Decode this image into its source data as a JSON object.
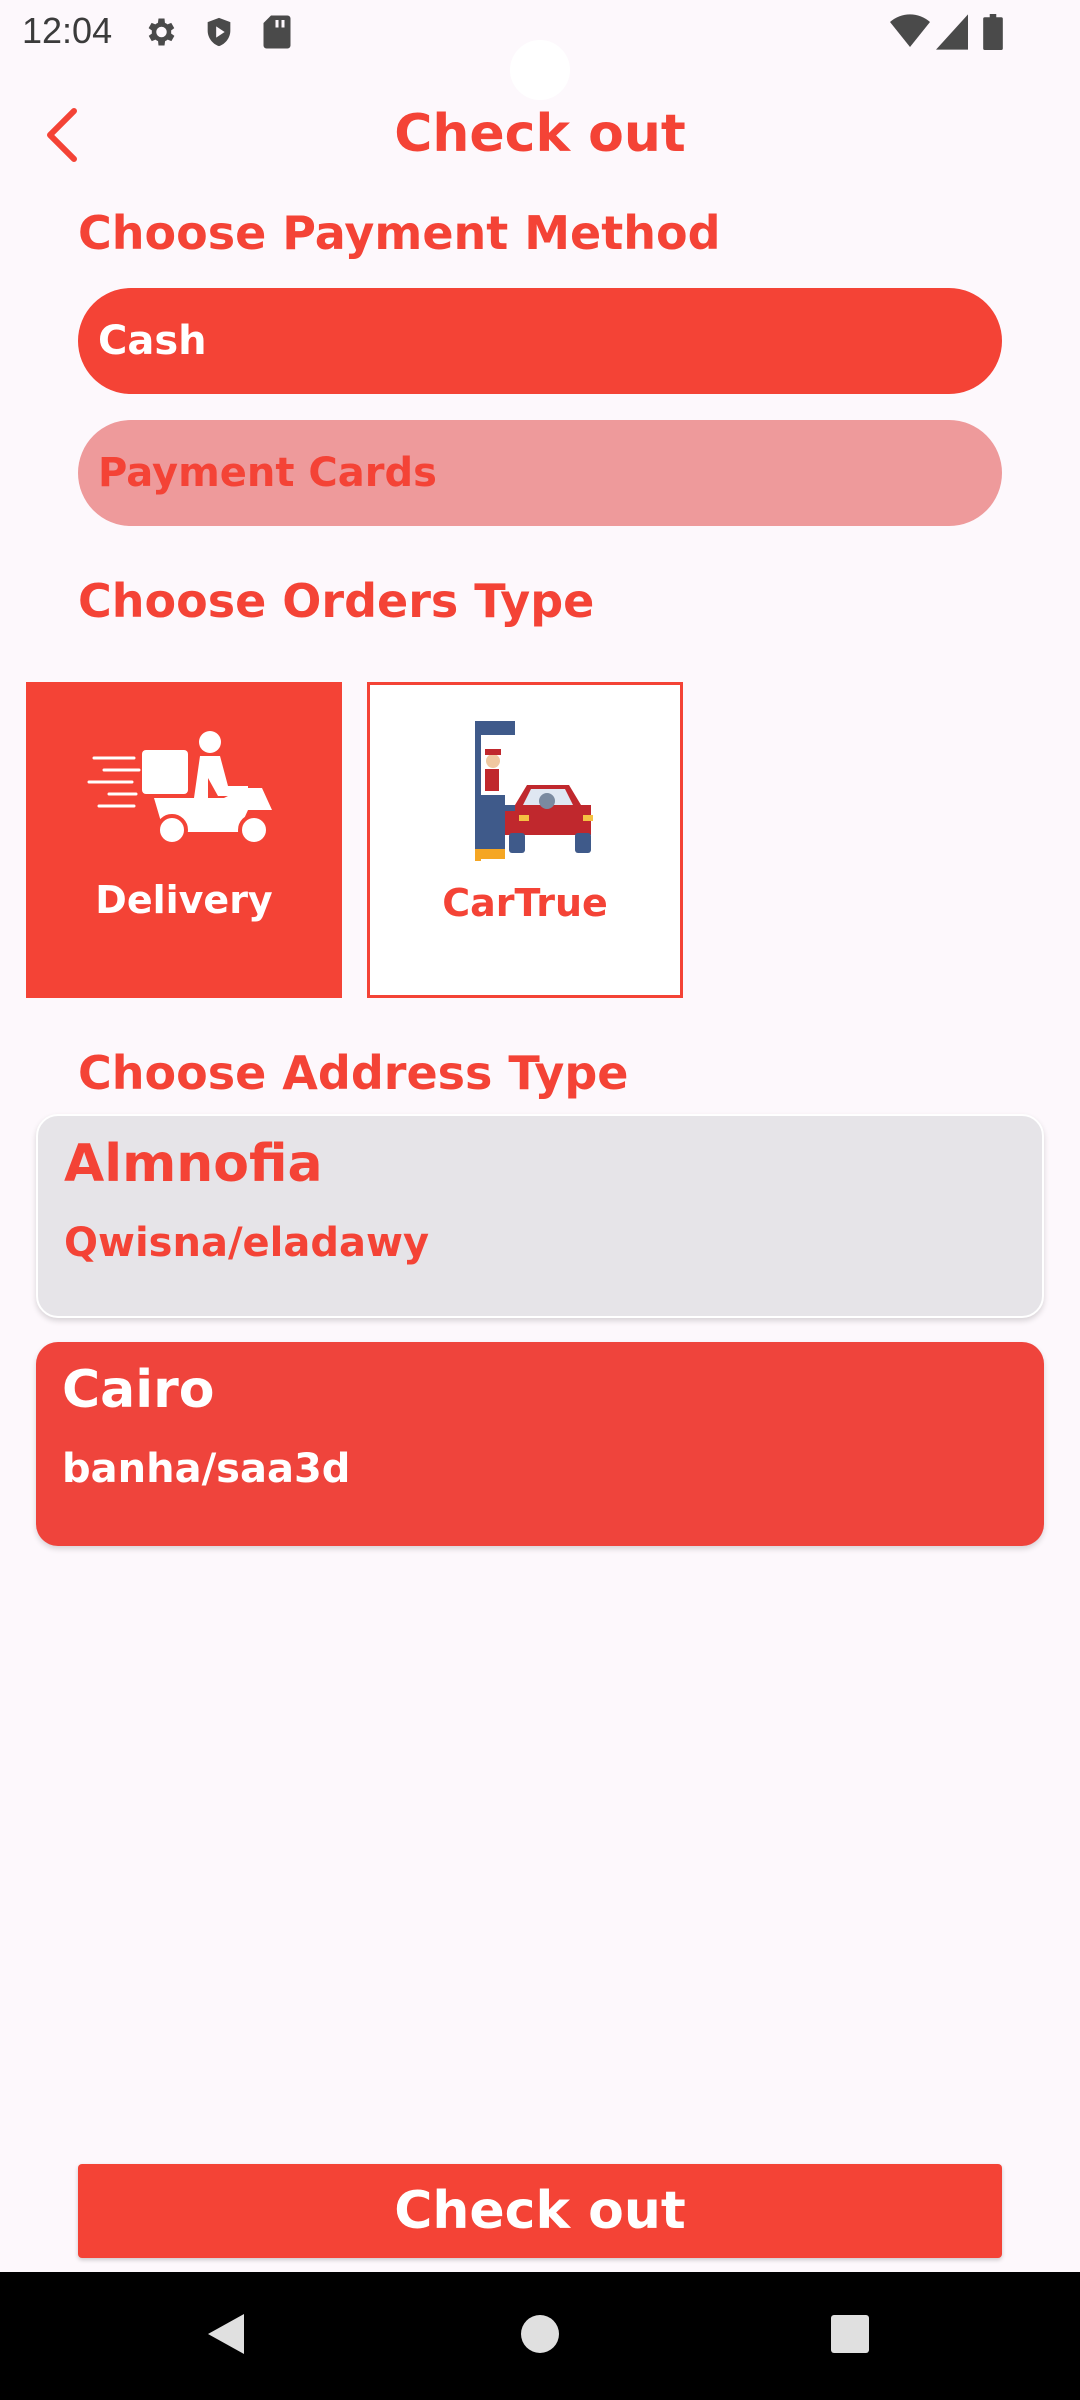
{
  "status_bar": {
    "time": "12:04",
    "icons_left": [
      "settings-icon",
      "shield-icon",
      "sd-card-icon"
    ],
    "icons_right": [
      "wifi-icon",
      "signal-icon",
      "battery-icon"
    ]
  },
  "header": {
    "title": "Check out",
    "back_icon": "chevron-left-icon"
  },
  "payment": {
    "section_title": "Choose Payment Method",
    "options": [
      {
        "label": "Cash",
        "selected": true
      },
      {
        "label": "Payment Cards",
        "selected": false
      }
    ]
  },
  "orders": {
    "section_title": "Choose Orders Type",
    "options": [
      {
        "label": "Delivery",
        "icon": "delivery-scooter-icon",
        "selected": true
      },
      {
        "label": "CarTrue",
        "icon": "drive-through-icon",
        "selected": false
      }
    ]
  },
  "address": {
    "section_title": "Choose Address Type",
    "options": [
      {
        "city": "Almnofia",
        "line": "Qwisna/eladawy",
        "selected": false
      },
      {
        "city": "Cairo",
        "line": "banha/saa3d",
        "selected": true
      }
    ]
  },
  "checkout_button": {
    "label": "Check out"
  },
  "colors": {
    "accent": "#f44336",
    "accent_light": "#ee9a9b",
    "background": "#fdf8fc",
    "card_unselected": "#e6e4e8"
  },
  "nav_bar": {
    "buttons": [
      "back-triangle-icon",
      "home-circle-icon",
      "recents-square-icon"
    ]
  }
}
